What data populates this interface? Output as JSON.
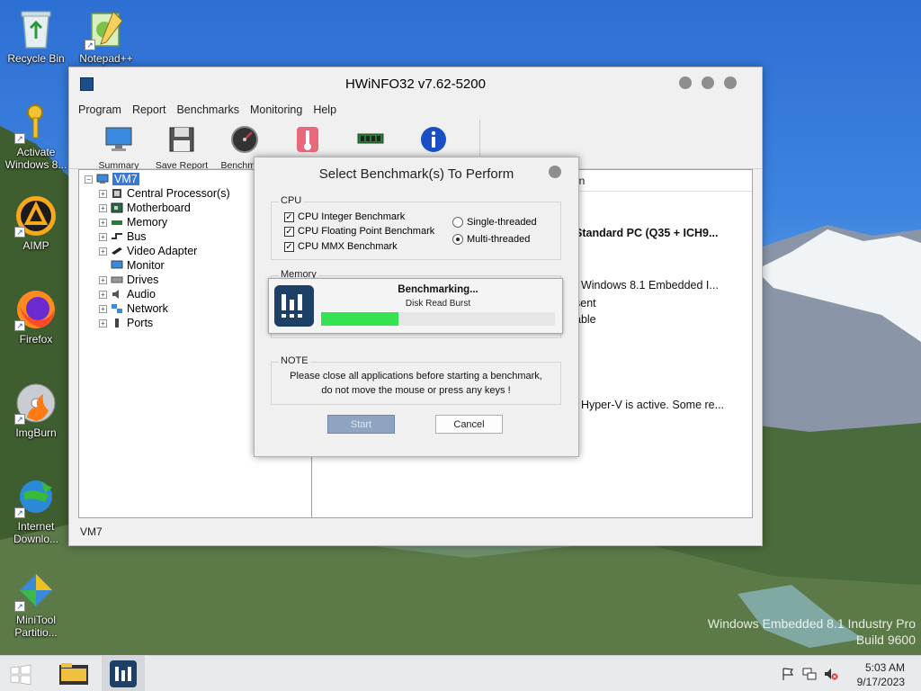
{
  "desktop": {
    "icons": [
      {
        "label": "Recycle Bin",
        "icon": "recycle-bin-icon"
      },
      {
        "label": "Notepad++",
        "icon": "notepad-plus-icon"
      },
      {
        "label": "Activate Windows 8...",
        "icon": "key-shield-icon"
      },
      {
        "label": "AIMP",
        "icon": "aimp-icon"
      },
      {
        "label": "Firefox",
        "icon": "firefox-icon"
      },
      {
        "label": "ImgBurn",
        "icon": "imgburn-icon"
      },
      {
        "label": "Internet Downlo...",
        "icon": "internet-download-icon"
      },
      {
        "label": "MiniTool Partitio...",
        "icon": "minitool-icon"
      }
    ],
    "watermark_line1": "Windows Embedded 8.1 Industry Pro",
    "watermark_line2": "Build 9600"
  },
  "window": {
    "title": "HWiNFO32 v7.62-5200",
    "menu": [
      "Program",
      "Report",
      "Benchmarks",
      "Monitoring",
      "Help"
    ],
    "toolbar": [
      {
        "label": "Summary",
        "icon": "monitor-icon"
      },
      {
        "label": "Save Report",
        "icon": "floppy-icon"
      },
      {
        "label": "Benchmark",
        "icon": "gauge-icon"
      },
      {
        "label": "",
        "icon": "thermometer-icon"
      },
      {
        "label": "",
        "icon": "memory-module-icon"
      },
      {
        "label": "",
        "icon": "info-icon"
      }
    ],
    "tree": {
      "root": "VM7",
      "items": [
        "Central Processor(s)",
        "Motherboard",
        "Memory",
        "Bus",
        "Video Adapter",
        "Monitor",
        "Drives",
        "Audio",
        "Network",
        "Ports"
      ]
    },
    "right_pane": {
      "header": "on",
      "line1": "Standard PC (Q35 + ICH9...",
      "line2": "t Windows 8.1 Embedded I...",
      "line3": "sent",
      "line4": "able",
      "line5": "t Hyper-V is active. Some re..."
    },
    "status": "VM7"
  },
  "dialog": {
    "title": "Select Benchmark(s) To Perform",
    "cpu_label": "CPU",
    "checks": [
      {
        "label": "CPU Integer Benchmark",
        "checked": true
      },
      {
        "label": "CPU Floating Point Benchmark",
        "checked": true
      },
      {
        "label": "CPU MMX Benchmark",
        "checked": true
      }
    ],
    "radios": [
      {
        "label": "Single-threaded",
        "selected": false
      },
      {
        "label": "Multi-threaded",
        "selected": true
      }
    ],
    "memory_label": "Memory",
    "note_label": "NOTE",
    "note_line1": "Please close all applications before starting a benchmark,",
    "note_line2": "do not move the mouse or press any keys  !",
    "start_label": "Start",
    "cancel_label": "Cancel"
  },
  "progress": {
    "title": "Benchmarking...",
    "subtitle": "Disk Read Burst",
    "percent": 33
  },
  "taskbar": {
    "time": "5:03 AM",
    "date": "9/17/2023"
  }
}
